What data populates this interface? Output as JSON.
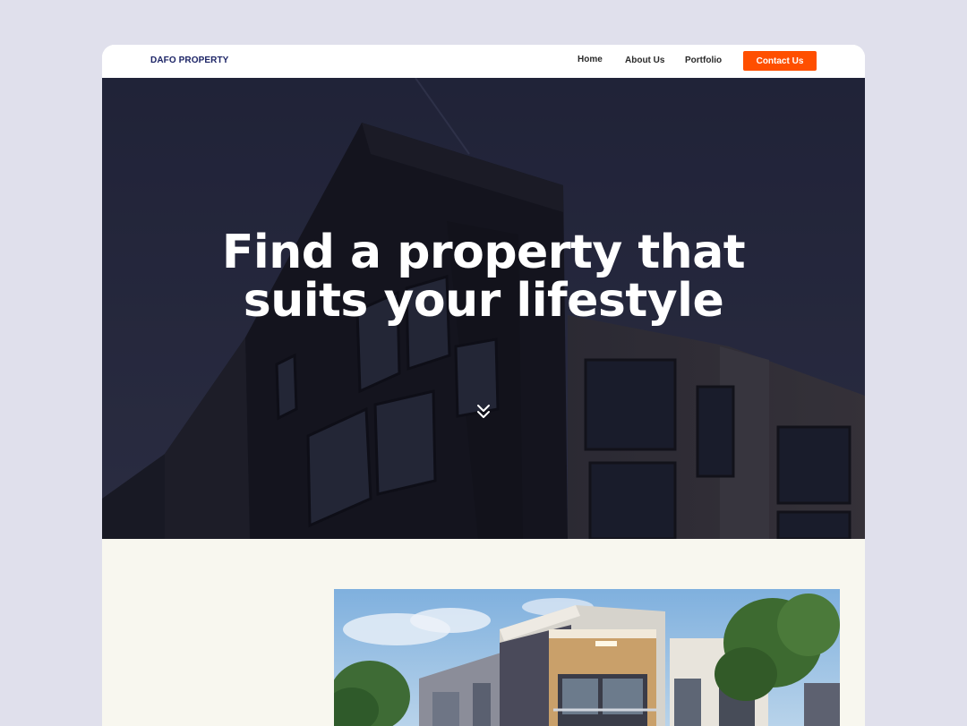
{
  "navbar": {
    "logo": "DAFO PROPERTY",
    "links": [
      {
        "label": "Home"
      },
      {
        "label": "About Us"
      },
      {
        "label": "Portfolio"
      }
    ],
    "cta_label": "Contact Us",
    "cta_color": "#ff4f00",
    "logo_color": "#1c2466"
  },
  "hero": {
    "title_line1": "Find a property that",
    "title_line2": "suits your lifestyle",
    "scroll_icon": "double-chevron-down-icon"
  },
  "section2": {
    "background": "#f8f7ef"
  }
}
